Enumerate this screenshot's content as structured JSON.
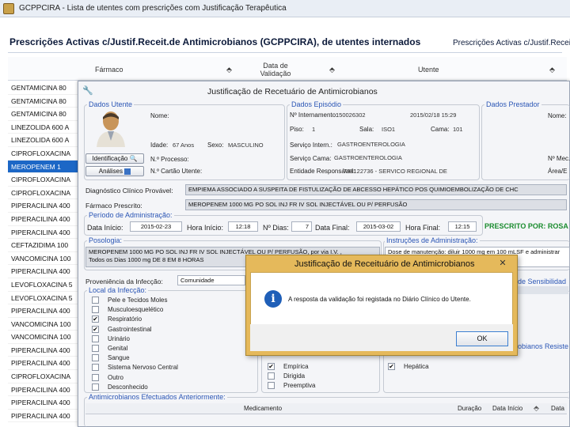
{
  "window": {
    "title": "GCPPCIRA - Lista de utentes com prescrições com Justificação Terapêutica"
  },
  "main": {
    "header": "Prescrições Activas c/Justif.Receit.de Antimicrobianos (GCPPCIRA), de utentes internados",
    "header_right": "Prescrições Activas c/Justif.Receit.",
    "columns": {
      "farmaco": "Fármaco",
      "data_validacao": "Data de Validação",
      "utente": "Utente"
    },
    "drugs": [
      "GENTAMICINA 80",
      "GENTAMICINA 80",
      "GENTAMICINA 80",
      "LINEZOLIDA 600 A",
      "LINEZOLIDA 600 A",
      "CIPROFLOXACINA",
      "MEROPENEM 1",
      "CIPROFLOXACINA",
      "CIPROFLOXACINA",
      "PIPERACILINA 400",
      "PIPERACILINA 400",
      "PIPERACILINA 400",
      "CEFTAZIDIMA 100",
      "VANCOMICINA 100",
      "PIPERACILINA 400",
      "LEVOFLOXACINA 5",
      "LEVOFLOXACINA 5",
      "PIPERACILINA 400",
      "VANCOMICINA 100",
      "VANCOMICINA 100",
      "PIPERACILINA 400",
      "PIPERACILINA 400",
      "CIPROFLOXACINA",
      "PIPERACILINA 400",
      "PIPERACILINA 400",
      "PIPERACILINA 400"
    ],
    "selected_drug_index": 6
  },
  "dialog": {
    "title": "Justificação de Recetuário de Antimicrobianos",
    "dados_utente": {
      "legend": "Dados Utente",
      "nome_label": "Nome:",
      "idade_label": "Idade:",
      "idade_value": "67 Anos",
      "sexo_label": "Sexo:",
      "sexo_value": "MASCULINO",
      "processo_label": "N.º Processo:",
      "cartao_label": "N.º Cartão Utente:",
      "btn_identificacao": "Identificação",
      "btn_analises": "Análises"
    },
    "dados_episodio": {
      "legend": "Dados Episódio",
      "internamento_label": "Nº Internamento:",
      "internamento_value": "150026302",
      "data_value": "2015/02/18 15:29",
      "piso_label": "Piso:",
      "piso_value": "1",
      "sala_label": "Sala:",
      "sala_value": "ISO1",
      "cama_label": "Cama:",
      "cama_value": "101",
      "servico_intern_label": "Serviço Intern.:",
      "servico_intern_value": "GASTROENTEROLOGIA",
      "servico_cama_label": "Serviço Cama:",
      "servico_cama_value": "GASTROENTEROLOGIA",
      "entidade_label": "Entidade Responsável:",
      "entidade_value": "798122736 - SERVICO REGIONAL DE"
    },
    "dados_prestador": {
      "legend": "Dados Prestador",
      "nome_label": "Nome:",
      "mec_label": "Nº Mec.",
      "area_label": "Área/E"
    },
    "diagnostico": {
      "label": "Diagnóstico Clínico Provável:",
      "value": "EMPIEMA ASSOCIADO A SUSPEITA DE FISTULIZAÇÃO DE ABCESSO HEPÁTICO POS QUIMIOEMBOLIZAÇÃO DE CHC"
    },
    "farmaco_prescrito": {
      "label": "Fármaco Prescrito:",
      "value": "MEROPENEM 1000 MG PO SOL INJ FR IV SOL INJECTÁVEL OU P/ PERFUSÃO"
    },
    "periodo": {
      "legend": "Período de Administração:",
      "data_inicio_label": "Data Início:",
      "data_inicio_value": "2015-02-23",
      "hora_inicio_label": "Hora Início:",
      "hora_inicio_value": "12:18",
      "n_dias_label": "Nº Dias:",
      "n_dias_value": "7",
      "data_final_label": "Data Final:",
      "data_final_value": "2015-03-02",
      "hora_final_label": "Hora Final:",
      "hora_final_value": "12:15",
      "prescrito_por": "PRESCRITO POR: ROSA"
    },
    "posologia": {
      "legend": "Posologia:",
      "line1": "MEROPENEM 1000 MG PO SOL INJ FR IV SOL INJECTÁVEL OU P/ PERFUSÃO, por via I.V. ,",
      "line2": "Todos os Dias 1000 mg DE 8 EM 8 HORAS"
    },
    "instrucoes": {
      "legend": "Instruções de Administração:",
      "value": "Dose de manutenção: diluir 1000 mg em 100 mLSF e administrar"
    },
    "proveniencia": {
      "label": "Proveniência da Infecção:",
      "value": "Comunidade"
    },
    "local_infeccao": {
      "legend": "Local da Infecção:",
      "items": [
        {
          "label": "Pele e Tecidos Moles",
          "checked": false
        },
        {
          "label": "Musculoesquelético",
          "checked": false
        },
        {
          "label": "Respiratório",
          "checked": true
        },
        {
          "label": "Gastrointestinal",
          "checked": true
        },
        {
          "label": "Urinário",
          "checked": false
        },
        {
          "label": "Genital",
          "checked": false
        },
        {
          "label": "Sangue",
          "checked": false
        },
        {
          "label": "Sistema Nervoso Central",
          "checked": false
        },
        {
          "label": "Outro",
          "checked": false
        },
        {
          "label": "Desconhecido",
          "checked": false
        }
      ]
    },
    "tipo_terapeutica": {
      "items": [
        {
          "label": "Empírica",
          "checked": true
        },
        {
          "label": "Dirigida",
          "checked": false
        },
        {
          "label": "Preemptiva",
          "checked": false
        }
      ]
    },
    "right_checks": {
      "items": [
        {
          "label": "Hepática",
          "checked": true
        }
      ]
    },
    "sensibilidade_label": "de Sensibilidad",
    "resistentes_label": "obianos Resiste",
    "antimicrobianos_anteriores": {
      "legend": "Antimicrobianos Efectuados Anteriormente:",
      "col_medicamento": "Medicamento",
      "col_duracao": "Duração",
      "col_data_inicio": "Data Início",
      "col_data": "Data"
    }
  },
  "message_box": {
    "title": "Justificação de Receituário de Antimicrobianos",
    "text": "A resposta da validação foi registada no Diário Clínico do Utente.",
    "ok": "OK"
  },
  "colors": {
    "selection": "#1c67c6",
    "legend_blue": "#2b56b5",
    "prescrito_green": "#1a8c2e",
    "msgbox_frame": "#e5b95b"
  }
}
